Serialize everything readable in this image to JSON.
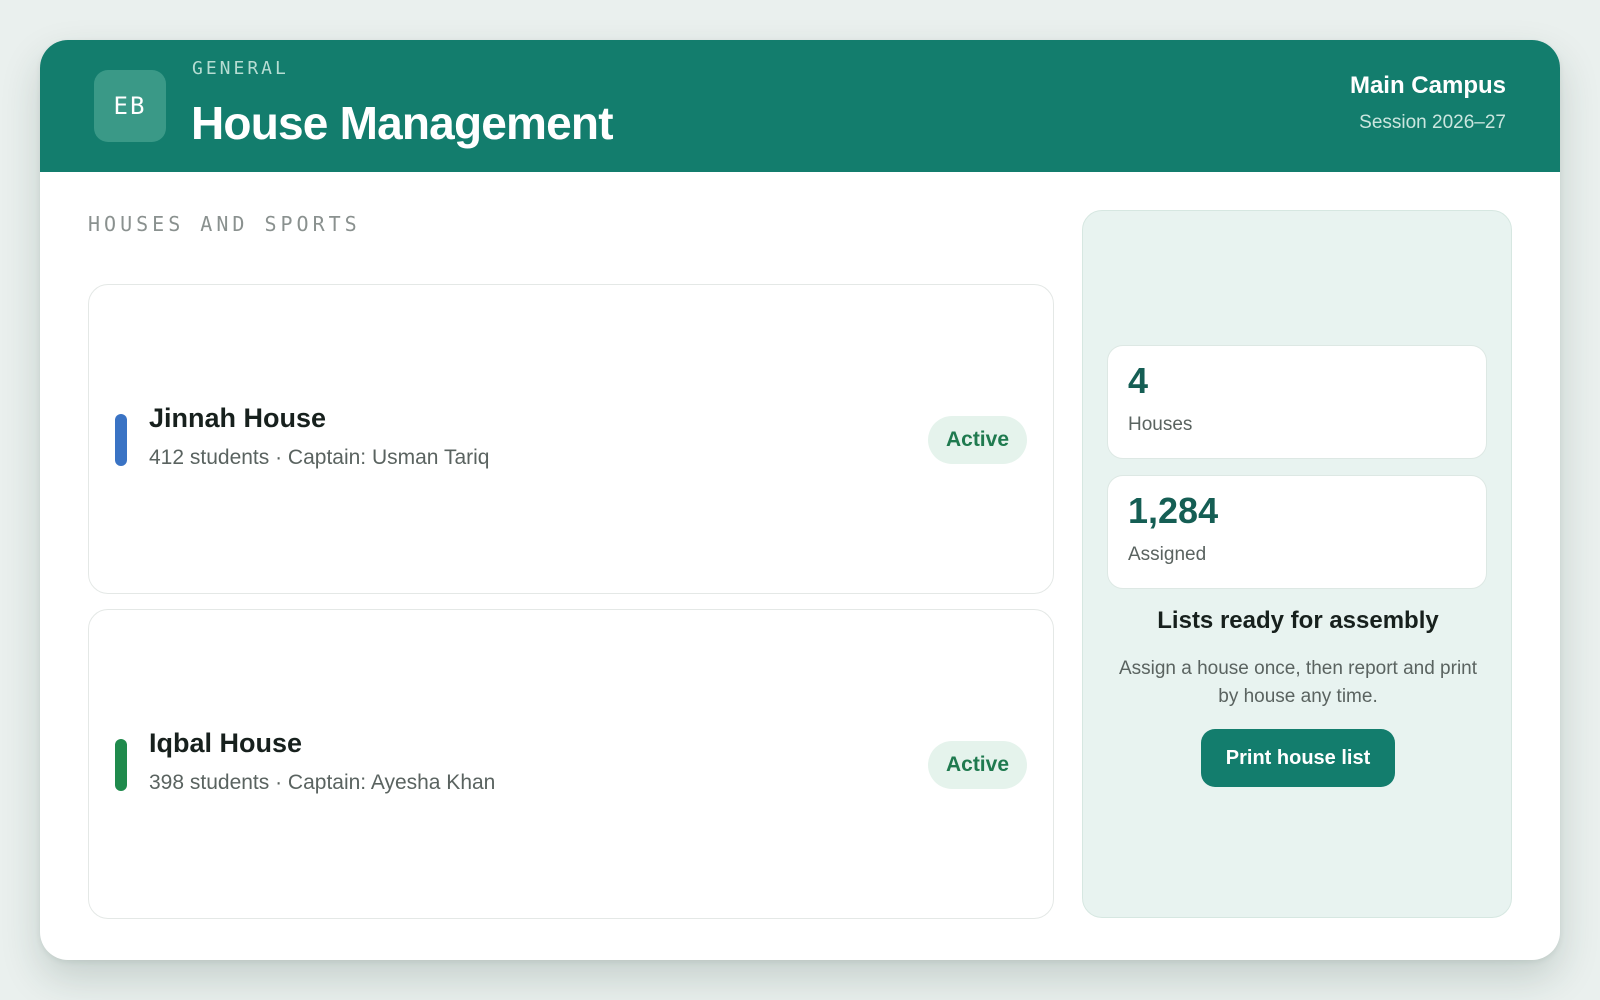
{
  "header": {
    "logo_initials": "EB",
    "eyebrow": "GENERAL",
    "title": "House Management",
    "campus": "Main Campus",
    "session": "Session 2026–27"
  },
  "main": {
    "section_label": "HOUSES AND SPORTS",
    "houses": [
      {
        "name": "Jinnah House",
        "meta": "412 students · Captain: Usman Tariq",
        "status": "Active",
        "color": "#3a73c4"
      },
      {
        "name": "Iqbal House",
        "meta": "398 students · Captain: Ayesha Khan",
        "status": "Active",
        "color": "#1f8a4c"
      }
    ]
  },
  "side_panel": {
    "stats": [
      {
        "value": "4",
        "label": "Houses"
      },
      {
        "value": "1,284",
        "label": "Assigned"
      }
    ],
    "heading": "Lists ready for assembly",
    "description": "Assign a house once, then report and print by house any time.",
    "print_button": "Print house list"
  },
  "colors": {
    "brand": "#137d6d",
    "status_active_bg": "#e5f3ec",
    "status_active_text": "#1f7a4f"
  }
}
